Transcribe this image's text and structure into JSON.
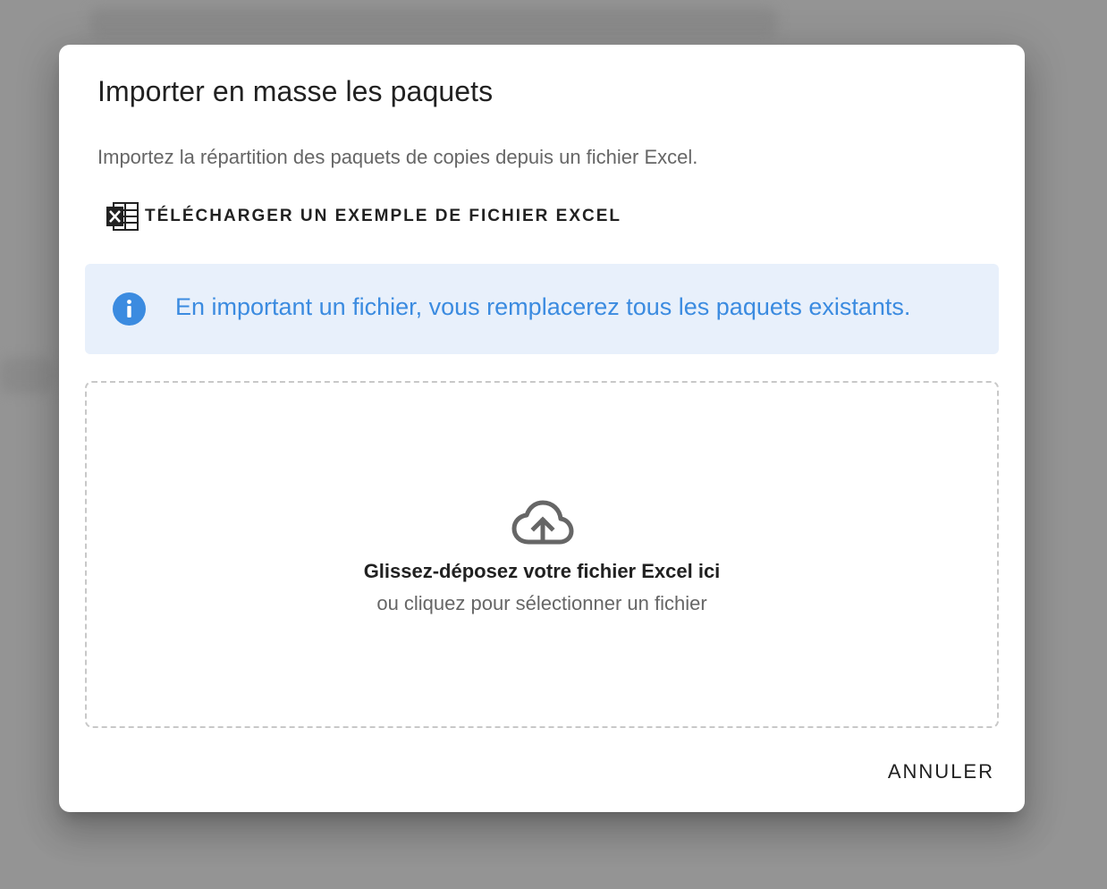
{
  "dialog": {
    "title": "Importer en masse les paquets",
    "description": "Importez la répartition des paquets de copies depuis un fichier Excel.",
    "download_label": "TÉLÉCHARGER UN EXEMPLE DE FICHIER EXCEL",
    "download_icon": "excel-file-icon",
    "alert": {
      "icon": "info-icon",
      "text": "En important un fichier, vous remplacerez tous les paquets existants.",
      "color": "#3b8be0",
      "background": "#e8f0fb"
    },
    "dropzone": {
      "icon": "cloud-upload-icon",
      "title": "Glissez-déposez votre fichier Excel ici",
      "subtitle": "ou cliquez pour sélectionner un fichier"
    },
    "cancel_label": "ANNULER"
  }
}
